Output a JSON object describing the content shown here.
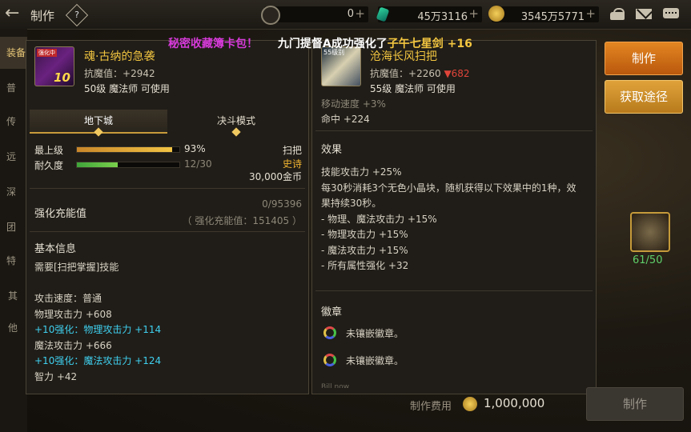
{
  "header": {
    "title": "制作",
    "help": "?"
  },
  "currencies": [
    {
      "name": "coin-c-icon",
      "value": "0"
    },
    {
      "name": "gem-icon",
      "value": "45万3116"
    },
    {
      "name": "gold-icon",
      "value": "3545万5771"
    }
  ],
  "left_tabs": [
    "装备",
    "普",
    "传",
    "远",
    "深",
    "团",
    "特",
    "其他"
  ],
  "banner": {
    "left_text": "秘密收藏簿卡包！",
    "right_text": "九门提督A成功强化了",
    "item": "子午七星剑 +16",
    "colors": {
      "left": "#d53ad8",
      "right": "#ffffff",
      "item": "#f3c640"
    }
  },
  "item1": {
    "badge": "强化中",
    "level_badge": "10",
    "name": "魂·古纳的急袭",
    "stat_label": "抗魔值：",
    "stat_value": "+2942",
    "req": "50级 魔法师 可使用"
  },
  "tabs": {
    "dungeon": "地下城",
    "duel": "决斗模式"
  },
  "bars": {
    "top_label": "最上级",
    "top_value": "93%",
    "top_fill": 0.93,
    "dur_label": "耐久度",
    "dur_value": "12/30",
    "dur_fill": 0.4
  },
  "right_info": {
    "type": "扫把",
    "rarity": "史诗",
    "price": "30,000金币"
  },
  "charge": {
    "label": "强化充能值",
    "value": "0/95396",
    "sub": "（ 强化充能值：151405 ）"
  },
  "basic": {
    "title": "基本信息",
    "lines": [
      {
        "text": "需要[扫把掌握]技能",
        "style": "normal"
      },
      {
        "text": "",
        "style": "normal"
      },
      {
        "text": "攻击速度：普通",
        "style": "normal"
      },
      {
        "text": "物理攻击力 +608",
        "style": "normal"
      },
      {
        "text": "+10强化：物理攻击力 +114",
        "style": "cyan"
      },
      {
        "text": "魔法攻击力 +666",
        "style": "normal"
      },
      {
        "text": "+10强化：魔法攻击力 +124",
        "style": "cyan"
      },
      {
        "text": "智力 +42",
        "style": "normal"
      }
    ]
  },
  "item2": {
    "level_badge": "55级别",
    "name": "沧海长风扫把",
    "stat_label": "抗魔值：",
    "stat_value": "+2260",
    "stat_diff": "▼682",
    "req": "55级 魔法师 可使用"
  },
  "compare": {
    "top_lines": [
      "移动速度 +3%",
      "命中 +224"
    ],
    "effect_title": "效果",
    "effect_lines": [
      "技能攻击力 +25%",
      "每30秒消耗3个无色小晶块，随机获得以下效果中的1种，效",
      "果持续30秒。",
      "- 物理、魔法攻击力 +15%",
      "- 物理攻击力 +15%",
      "- 魔法攻击力 +15%",
      "- 所有属性强化 +32"
    ],
    "emblem_title": "徽章",
    "emblems": [
      "未镶嵌徽章。",
      "未镶嵌徽章。"
    ],
    "cut_text": "Bill now"
  },
  "buttons": {
    "make": "制作",
    "obtain": "获取途径",
    "make_bottom": "制作"
  },
  "material": {
    "count": "61/50"
  },
  "cost": {
    "label": "制作费用",
    "value": "1,000,000"
  }
}
